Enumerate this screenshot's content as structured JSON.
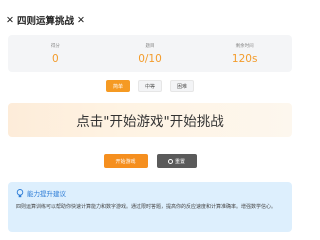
{
  "header": {
    "title": "四则运算挑战"
  },
  "stats": [
    {
      "label": "得分",
      "value": "0"
    },
    {
      "label": "题目",
      "value": "0/10"
    },
    {
      "label": "剩余时间",
      "value": "120s"
    }
  ],
  "difficulty": {
    "options": [
      "简单",
      "中等",
      "困难"
    ],
    "selected": "简单"
  },
  "question": {
    "text": "点击\"开始游戏\"开始挑战"
  },
  "actions": {
    "start_label": "开始游戏",
    "reset_label": "重置"
  },
  "tips": {
    "title": "能力提升建议",
    "text": "四则运算训练可以帮助你快速计算能力和数字游戏。通过限时答题，提高你的反应速度和计算准确率。增强数学信心。"
  }
}
